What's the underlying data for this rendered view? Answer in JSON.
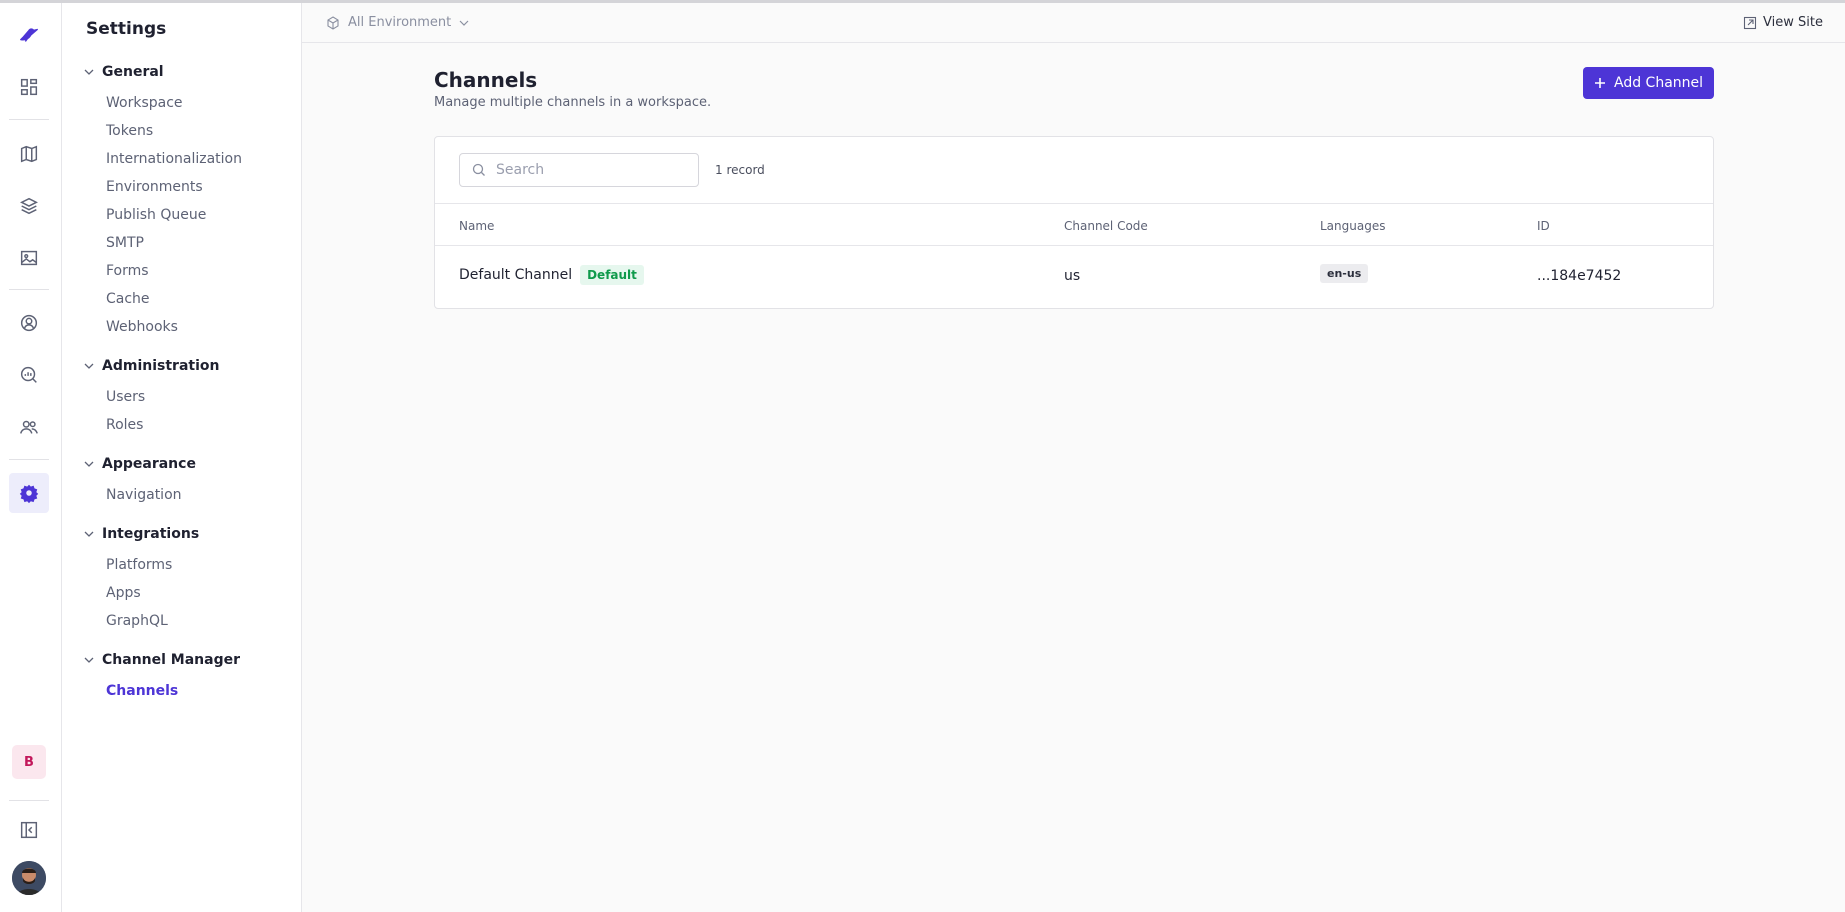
{
  "rail": {
    "icons": [
      "logo-icon",
      "dashboard-icon",
      "content-models-icon",
      "entries-icon",
      "assets-icon",
      "personalize-icon",
      "analytics-icon",
      "teams-icon",
      "settings-icon"
    ],
    "badge": "B"
  },
  "sidebar": {
    "title": "Settings",
    "groups": [
      {
        "label": "General",
        "items": [
          "Workspace",
          "Tokens",
          "Internationalization",
          "Environments",
          "Publish Queue",
          "SMTP",
          "Forms",
          "Cache",
          "Webhooks"
        ]
      },
      {
        "label": "Administration",
        "items": [
          "Users",
          "Roles"
        ]
      },
      {
        "label": "Appearance",
        "items": [
          "Navigation"
        ]
      },
      {
        "label": "Integrations",
        "items": [
          "Platforms",
          "Apps",
          "GraphQL"
        ]
      },
      {
        "label": "Channel Manager",
        "items": [
          "Channels"
        ]
      }
    ],
    "active_item": "Channels"
  },
  "topbar": {
    "environment": "All Environment",
    "view_site": "View Site"
  },
  "main": {
    "title": "Channels",
    "subtitle": "Manage multiple channels in a workspace.",
    "add_button": "Add Channel",
    "search_placeholder": "Search",
    "record_count": "1 record",
    "columns": [
      "Name",
      "Channel Code",
      "Languages",
      "ID"
    ],
    "rows": [
      {
        "name": "Default Channel",
        "badge": "Default",
        "code": "us",
        "language": "en-us",
        "id": "...184e7452"
      }
    ]
  },
  "colors": {
    "accent": "#4d35d6",
    "default_badge": "#0f9a4b"
  }
}
